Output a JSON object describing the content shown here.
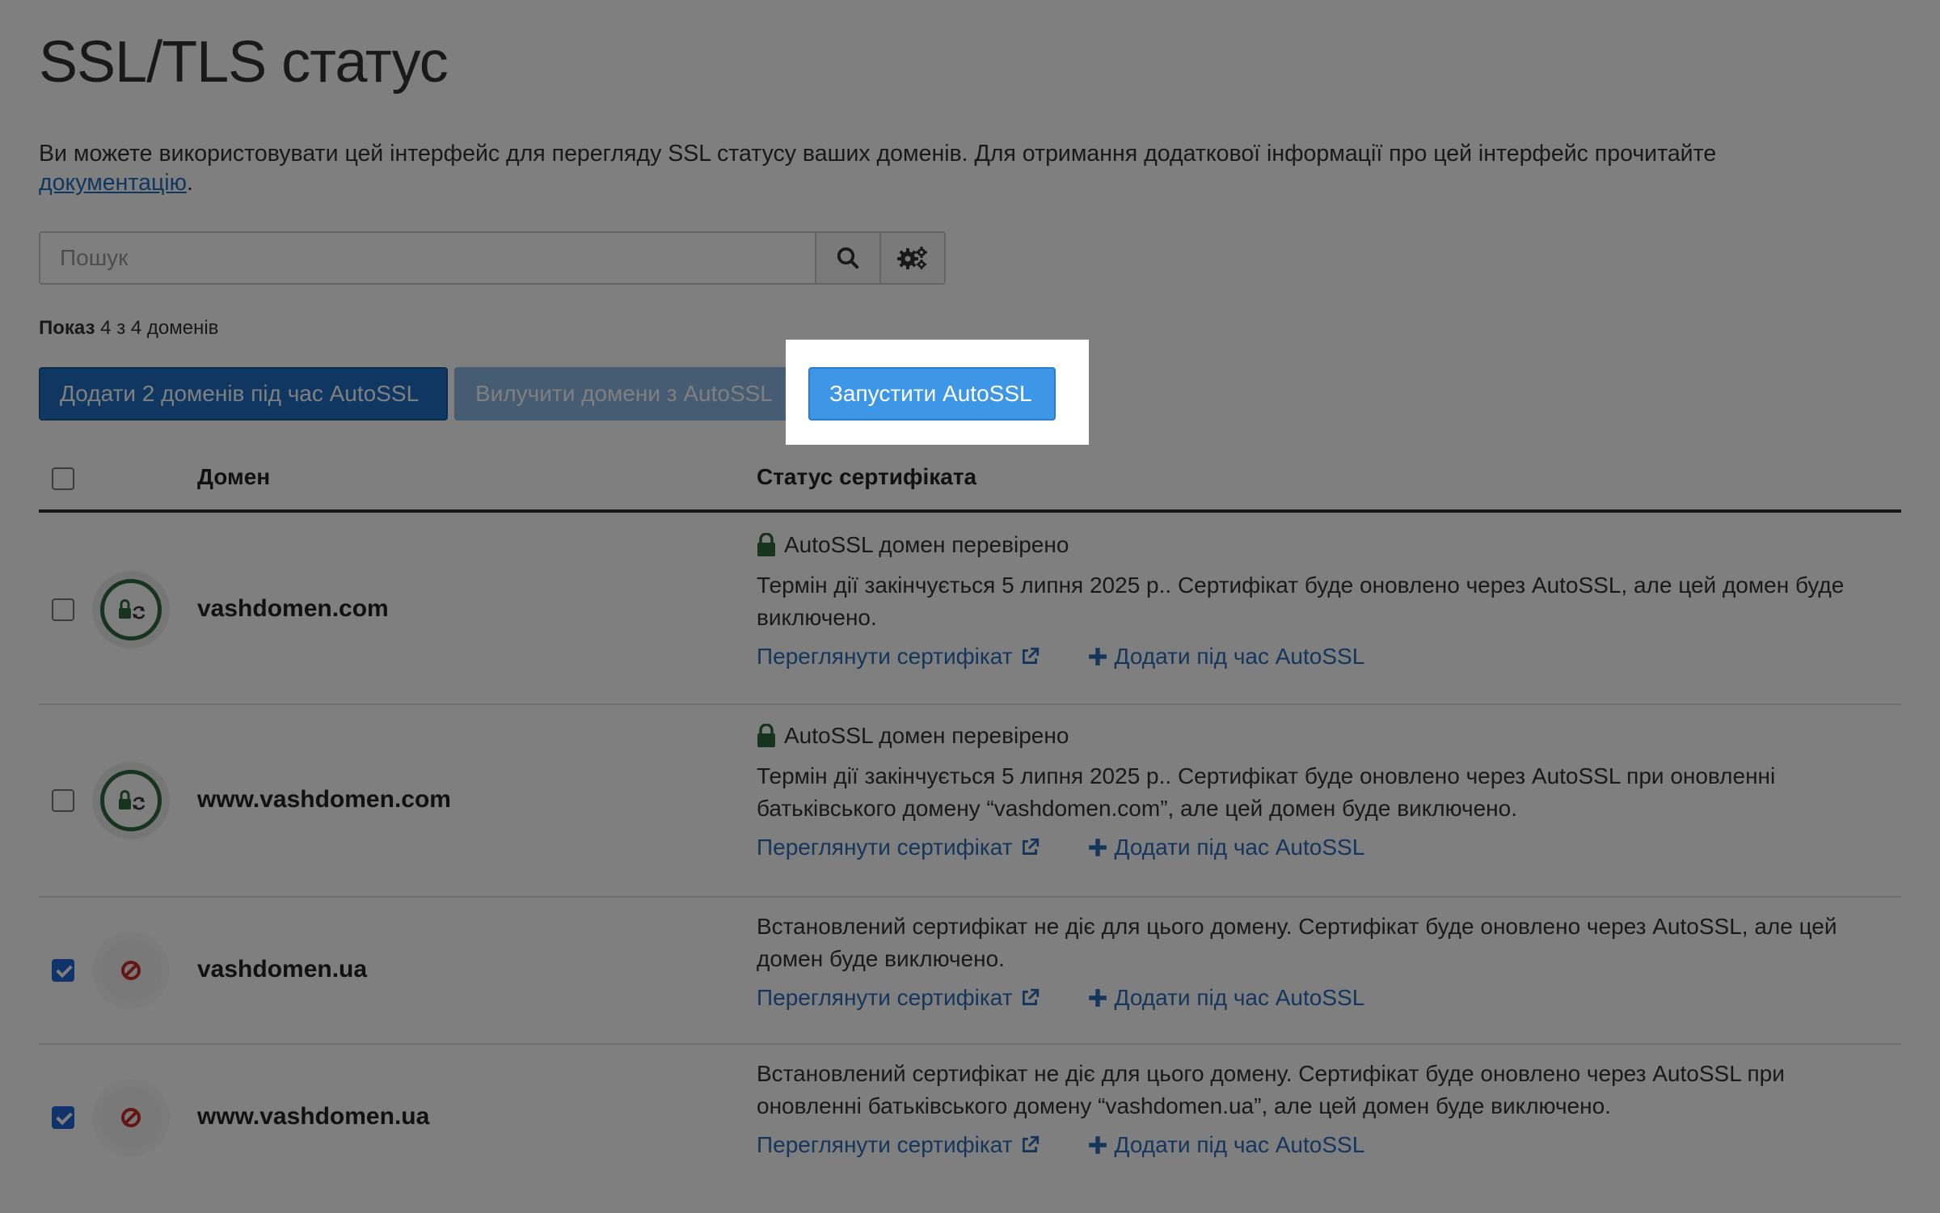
{
  "page": {
    "title": "SSL/TLS статус",
    "intro_text": "Ви можете використовувати цей інтерфейс для перегляду SSL статусу ваших доменів. Для отримання додаткової інформації про цей інтерфейс прочитайте",
    "intro_link": "документацію",
    "intro_end": "."
  },
  "search": {
    "placeholder": "Пошук",
    "search_icon": "search-icon",
    "settings_icon": "gears-icon"
  },
  "showing": {
    "label": "Показ",
    "value": "4 з 4 доменів"
  },
  "actions": {
    "add_label": "Додати 2 доменів під час AutoSSL",
    "exclude_label": "Вилучити домени з AutoSSL",
    "run_label": "Запустити AutoSSL"
  },
  "table": {
    "col_domain": "Домен",
    "col_status": "Статус сертифіката",
    "rows": [
      {
        "domain": "vashdomen.com",
        "checked": false,
        "icon": "lock-sync-icon",
        "status_title": "AutoSSL домен перевірено",
        "status_text": "Термін дії закінчується 5 липня 2025 р.. Сертифікат буде оновлено через AutoSSL, але цей домен буде виключено.",
        "view_label": "Переглянути сертифікат",
        "add_label": "Додати під час AutoSSL"
      },
      {
        "domain": "www.vashdomen.com",
        "checked": false,
        "icon": "lock-sync-icon",
        "status_title": "AutoSSL домен перевірено",
        "status_text": "Термін дії закінчується 5 липня 2025 р.. Сертифікат буде оновлено через AutoSSL при оновленні батьківського домену “vashdomen.com”, але цей домен буде виключено.",
        "view_label": "Переглянути сертифікат",
        "add_label": "Додати під час AutoSSL"
      },
      {
        "domain": "vashdomen.ua",
        "checked": true,
        "icon": "ban-icon",
        "status_text": "Встановлений сертифікат не діє для цього домену. Сертифікат буде оновлено через AutoSSL, але цей домен буде виключено.",
        "view_label": "Переглянути сертифікат",
        "add_label": "Додати під час AutoSSL"
      },
      {
        "domain": "www.vashdomen.ua",
        "checked": true,
        "icon": "ban-icon",
        "status_text": "Встановлений сертифікат не діє для цього домену. Сертифікат буде оновлено через AutoSSL при оновленні батьківського домену “vashdomen.ua”, але цей домен буде виключено.",
        "view_label": "Переглянути сертифікат",
        "add_label": "Додати під час AutoSSL"
      }
    ]
  },
  "colors": {
    "primary": "#1e6fc2",
    "link": "#2a6db8",
    "ok": "#2f6b3c",
    "error": "#cc2a2a",
    "dim_overlay": "rgba(0,0,0,0.5)"
  }
}
